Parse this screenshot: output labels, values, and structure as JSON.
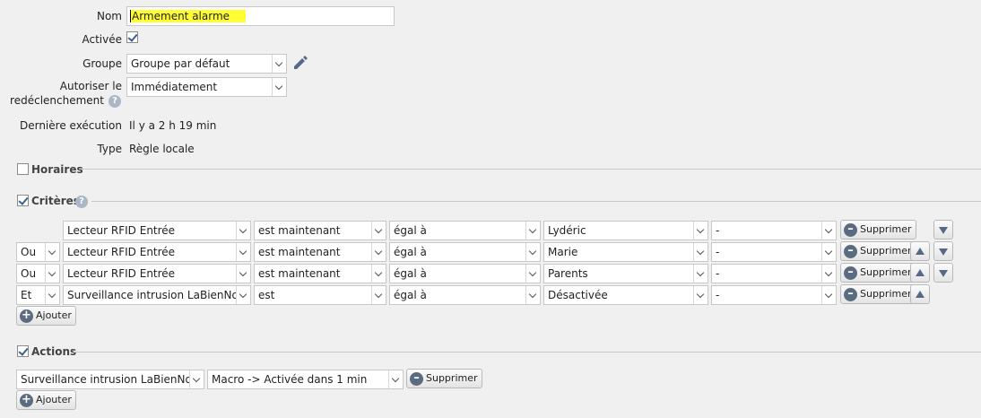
{
  "form": {
    "name_label": "Nom",
    "name_value": "Armement alarme",
    "enabled_label": "Activée",
    "group_label": "Groupe",
    "group_value": "Groupe par défaut",
    "retrigger_label_1": "Autoriser le",
    "retrigger_label_2": "redéclenchement",
    "retrigger_value": "Immédiatement",
    "last_exec_label": "Dernière exécution",
    "last_exec_value": "Il y a 2 h 19 min",
    "type_label": "Type",
    "type_value": "Règle locale"
  },
  "sections": {
    "schedules": "Horaires",
    "criteria": "Critères",
    "actions": "Actions"
  },
  "criteria": [
    {
      "conj": "",
      "device": "Lecteur RFID Entrée",
      "when": "est maintenant",
      "op": "égal à",
      "value": "Lydéric",
      "extra": "-"
    },
    {
      "conj": "Ou",
      "device": "Lecteur RFID Entrée",
      "when": "est maintenant",
      "op": "égal à",
      "value": "Marie",
      "extra": "-"
    },
    {
      "conj": "Ou",
      "device": "Lecteur RFID Entrée",
      "when": "est maintenant",
      "op": "égal à",
      "value": "Parents",
      "extra": "-"
    },
    {
      "conj": "Et",
      "device": "Surveillance intrusion LaBienNomm",
      "when": "est",
      "op": "égal à",
      "value": "Désactivée",
      "extra": "-"
    }
  ],
  "buttons": {
    "delete": "Supprimer",
    "add": "Ajouter"
  },
  "actions": [
    {
      "device": "Surveillance intrusion LaBienNomm",
      "macro": "Macro -> Activée dans 1 min"
    }
  ],
  "help_glyph": "?",
  "colors": {
    "highlight": "#ffff33",
    "background": "#f0f0f0",
    "icon_blue": "#566a88"
  }
}
